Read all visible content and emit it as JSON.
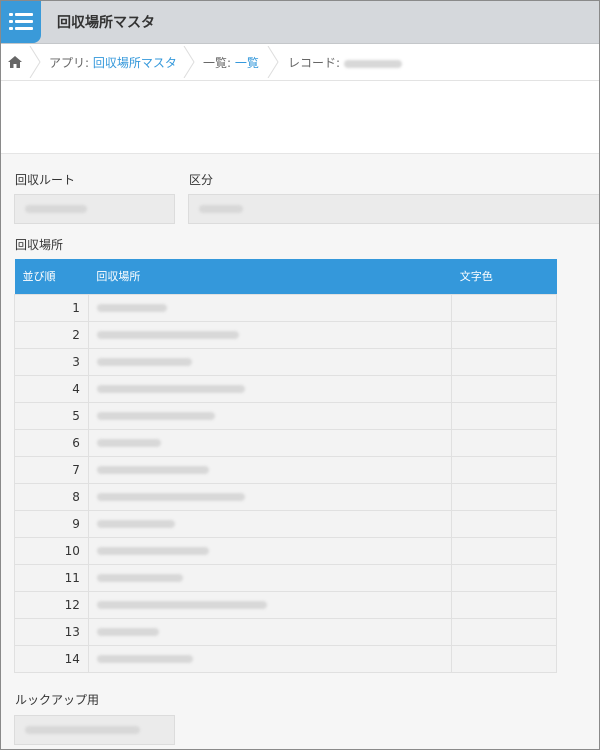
{
  "app": {
    "title": "回収場所マスタ"
  },
  "breadcrumb": {
    "app_prefix": "アプリ: ",
    "app_link": "回収場所マスタ",
    "list_prefix": "一覧: ",
    "list_link": "一覧",
    "record_prefix": "レコード: "
  },
  "form": {
    "route_label": "回収ルート",
    "category_label": "区分",
    "location_label": "回収場所",
    "lookup_label": "ルックアップ用"
  },
  "table": {
    "headers": [
      "並び順",
      "回収場所",
      "文字色"
    ],
    "rows": [
      "1",
      "2",
      "3",
      "4",
      "5",
      "6",
      "7",
      "8",
      "9",
      "10",
      "11",
      "12",
      "13",
      "14"
    ]
  },
  "colors": {
    "accent": "#3498db",
    "header_bg": "#d5d8dc"
  }
}
